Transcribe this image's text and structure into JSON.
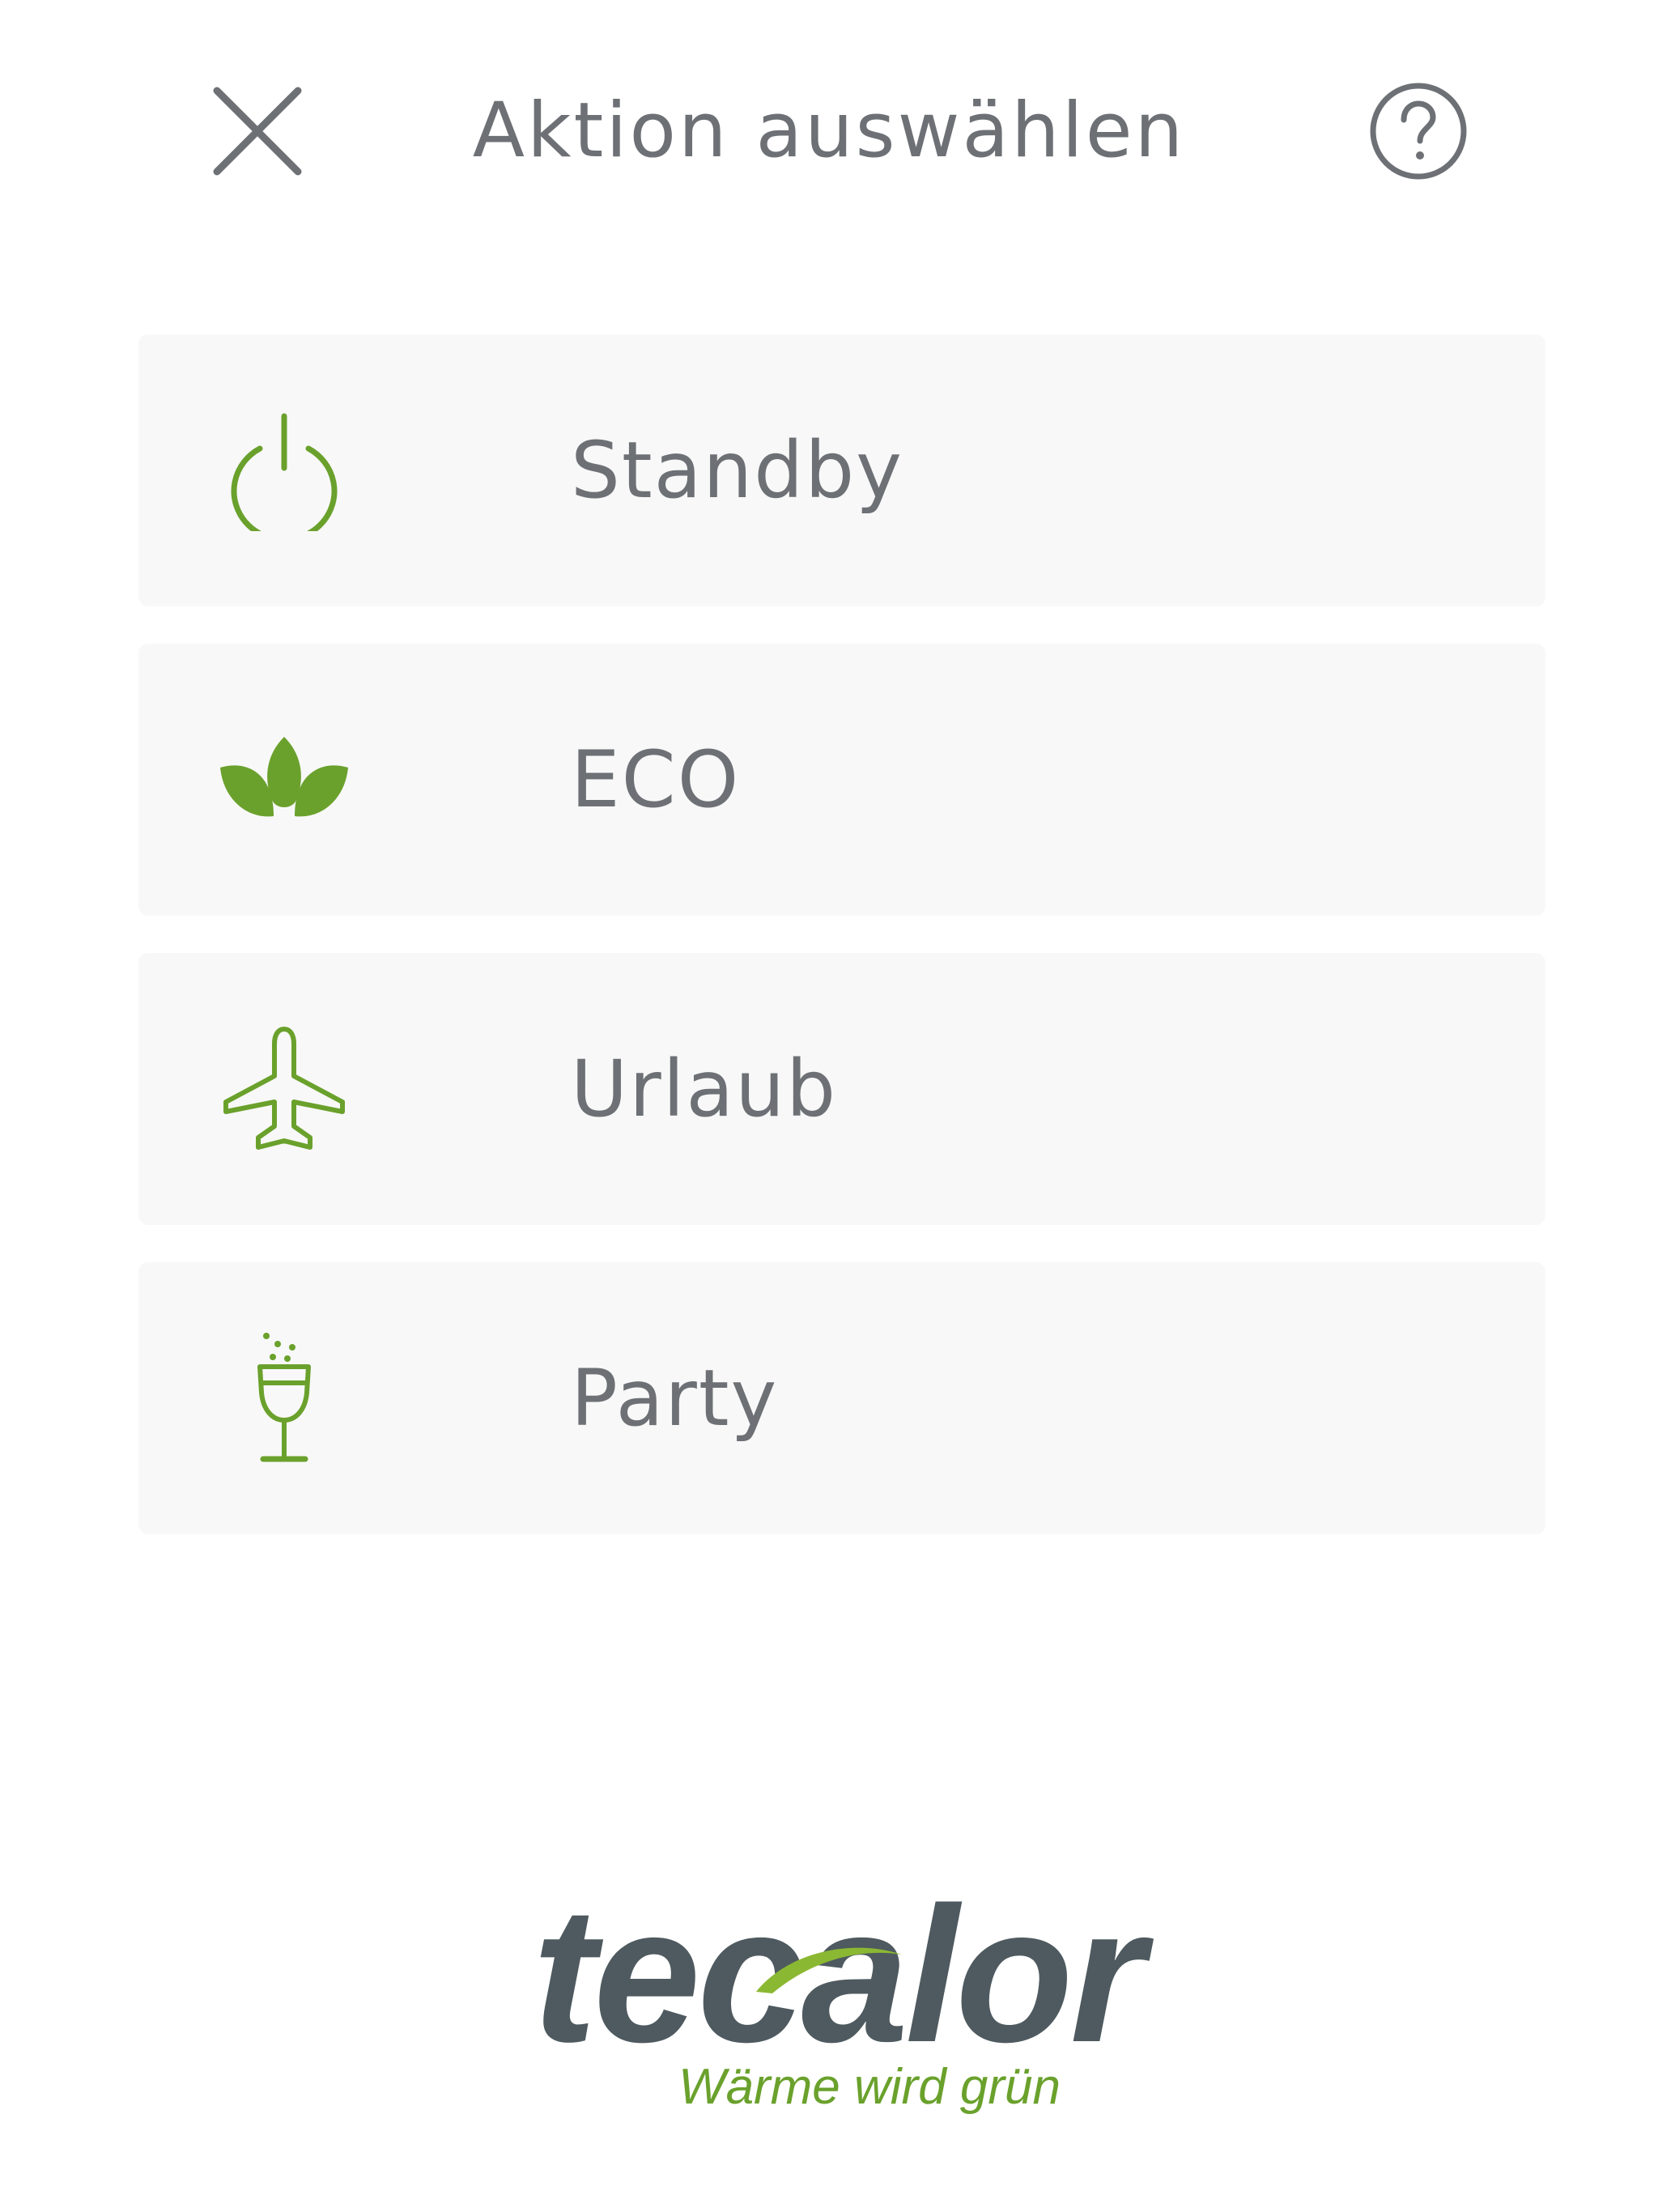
{
  "header": {
    "title": "Aktion auswählen",
    "close_icon": "close-icon",
    "help_icon": "help-circle-icon"
  },
  "actions": [
    {
      "label": "Standby",
      "icon": "power-icon"
    },
    {
      "label": "ECO",
      "icon": "leaves-icon"
    },
    {
      "label": "Urlaub",
      "icon": "airplane-icon"
    },
    {
      "label": "Party",
      "icon": "champagne-glass-icon"
    }
  ],
  "brand": {
    "name": "tecalor",
    "tagline": "Wärme wird grün"
  },
  "colors": {
    "accent_green": "#6aa12c",
    "text_gray": "#6d7075",
    "card_background": "#f8f8f8",
    "logo_gray": "#4e5a5f"
  }
}
